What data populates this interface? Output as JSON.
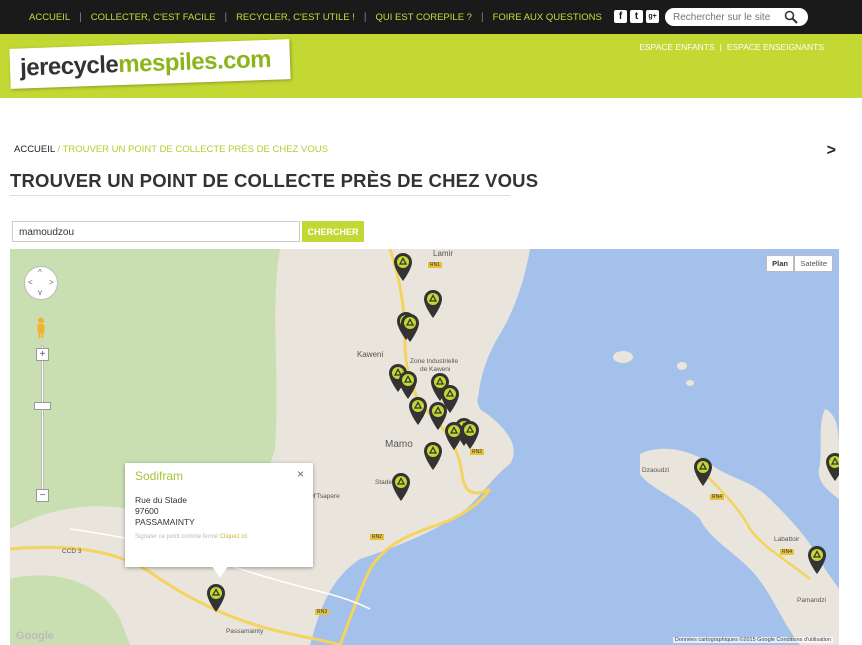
{
  "topnav": {
    "items": [
      "ACCUEIL",
      "COLLECTER, C'EST FACILE",
      "RECYCLER, C'EST UTILE !",
      "QUI EST COREPILE ?",
      "FOIRE AUX QUESTIONS"
    ],
    "social": {
      "facebook": "f",
      "twitter": "t",
      "google": "g+"
    },
    "search_placeholder": "Rechercher sur le site"
  },
  "header": {
    "logo_part1": "jerecycle",
    "logo_part2": "mespiles",
    "logo_part3": ".com",
    "space_kids": "ESPACE ENFANTS",
    "space_separator": "|",
    "space_teachers": "ESPACE ENSEIGNANTS"
  },
  "breadcrumb": {
    "home": "ACCUEIL",
    "current": "/ TROUVER UN POINT DE COLLECTE PRÈS DE CHEZ VOUS"
  },
  "page_title": "TROUVER UN POINT DE COLLECTE PRÈS DE CHEZ VOUS",
  "search": {
    "value": "mamoudzou",
    "button": "CHERCHER"
  },
  "map": {
    "type_plan": "Plan",
    "type_satellite": "Satellite",
    "labels": {
      "kaweni": "Kaweni",
      "zone_industrielle": "Zone Industrielle",
      "de_kaweni": "de Kaweni",
      "mamoudzou": "Mamo",
      "mtsapere": "M'Tsapere",
      "stade": "Stade",
      "dzaoudzi": "Dzaoudzi",
      "labattoir": "Labattoir",
      "pamandzi": "Pamandzi",
      "passamainty": "Passamainty",
      "lamir": "Lamir",
      "ccd": "CCD 3"
    },
    "google": "Google",
    "credit": "Données cartographiques ©2015 Google    Conditions d'utilisation",
    "infowindow": {
      "title": "Sodifram",
      "close": "×",
      "street": "Rue du Stade",
      "postcode": "97600",
      "city": "PASSAMAINTY",
      "note": "Signaler ce point comme fermé",
      "note_link": "Cliquez ici"
    }
  },
  "colors": {
    "accent": "#c3d833",
    "nav_bg": "#1a1a1a",
    "nav_text": "#c9dc3c",
    "water": "#a3c1ea",
    "land": "#e9e5dc",
    "forest": "#c9dfb1",
    "marker": "#333333"
  }
}
